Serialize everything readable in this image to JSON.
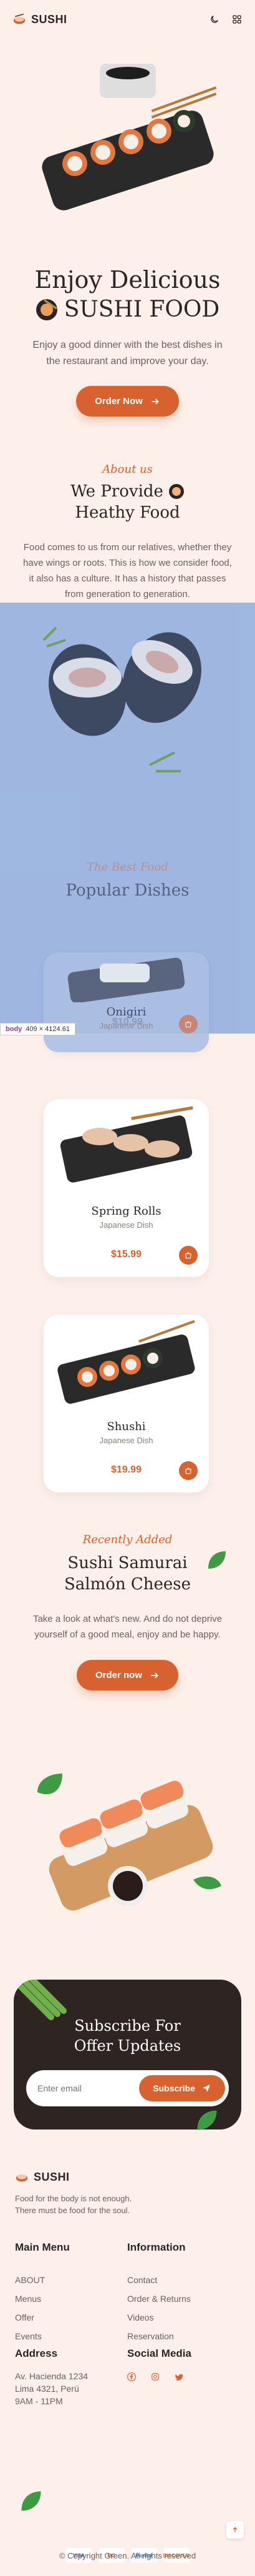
{
  "header": {
    "logo_text": "SUSHI",
    "icons": [
      "moon-icon",
      "grid-icon"
    ]
  },
  "hero": {
    "title_line1": "Enjoy Delicious",
    "title_line2": "SUSHI FOOD",
    "description": "Enjoy a good dinner with the best dishes in the restaurant and improve your day.",
    "button_label": "Order Now"
  },
  "about": {
    "tag": "About us",
    "title_line1": "We Provide",
    "title_line2": "Heathy Food",
    "text": "Food comes to us from our relatives, whether they have wings or roots. This is how we consider food, it also has a culture. It has a history that passes from generation to generation."
  },
  "popular": {
    "tag": "The Best Food",
    "title": "Popular Dishes",
    "dishes": [
      {
        "name": "Onigiri",
        "type": "Japanese Dish",
        "price": "$10.99"
      },
      {
        "name": "Spring Rolls",
        "type": "Japanese Dish",
        "price": "$15.99"
      },
      {
        "name": "Shushi",
        "type": "Japanese Dish",
        "price": "$19.99"
      }
    ]
  },
  "inspector": {
    "tag": "body",
    "size": "409 × 4124.61"
  },
  "recently": {
    "tag": "Recently Added",
    "title_line1": "Sushi Samurai",
    "title_line2": "Salmón Cheese",
    "text": "Take a look at what's new. And do not deprive yourself of a good meal, enjoy and be happy.",
    "button_label": "Order now"
  },
  "subscribe": {
    "title_line1": "Subscribe For",
    "title_line2": "Offer Updates",
    "placeholder": "Enter email",
    "button_label": "Subscribe"
  },
  "footer": {
    "logo_text": "SUSHI",
    "description": "Food for the body is not enough. There must be food for the soul.",
    "main_menu_title": "Main Menu",
    "main_menu": [
      "ABOUT",
      "Menus",
      "Offer",
      "Events"
    ],
    "information_title": "Information",
    "information": [
      "Contact",
      "Order & Returns",
      "Videos",
      "Reservation"
    ],
    "address_title": "Address",
    "address_line1": "Av. Hacienda 1234",
    "address_line2": "Lima 4321, Perú",
    "address_line3": "9AM - 11PM",
    "social_title": "Social Media",
    "social_icons": [
      "facebook-icon",
      "instagram-icon",
      "twitter-icon"
    ],
    "payments": [
      "VISA",
      "MC",
      "PayPal",
      "DISCOVER"
    ],
    "copyright": "© Copyright Green. All rights reserved"
  },
  "colors": {
    "accent": "#d8622f",
    "background": "#fdf0ea",
    "dark": "#2e2422",
    "overlay_blue": "#9ab4e0"
  }
}
